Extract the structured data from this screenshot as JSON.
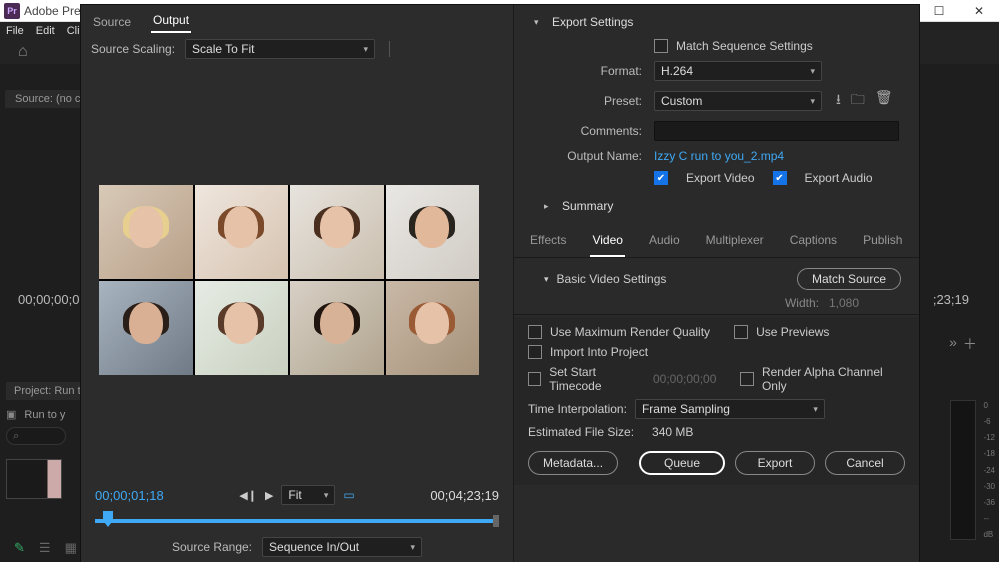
{
  "app": {
    "title": "Adobe Prem",
    "icon_text": "Pr"
  },
  "menubar": [
    "File",
    "Edit",
    "Clip"
  ],
  "source_tab_label": "Source: (no cli",
  "bg_timeline": {
    "left_tc": "00;00;00;0",
    "right_tc": ";23;19"
  },
  "project": {
    "tab": "Project: Run to",
    "name": "Run to y",
    "search_glyph": "⌕"
  },
  "audio_scale": [
    "0",
    "-6",
    "-12",
    "-18",
    "-24",
    "-30",
    "-36",
    "--",
    "dB"
  ],
  "export": {
    "tabs": {
      "source": "Source",
      "output": "Output"
    },
    "source_scaling_label": "Source Scaling:",
    "source_scaling_value": "Scale To Fit",
    "tc_current": "00;00;01;18",
    "tc_duration": "00;04;23;19",
    "fit_label": "Fit",
    "source_range_label": "Source Range:",
    "source_range_value": "Sequence In/Out",
    "settings_title": "Export Settings",
    "match_seq": "Match Sequence Settings",
    "format_label": "Format:",
    "format_value": "H.264",
    "preset_label": "Preset:",
    "preset_value": "Custom",
    "comments_label": "Comments:",
    "output_name_label": "Output Name:",
    "output_name_value": "Izzy C run to you_2.mp4",
    "export_video": "Export Video",
    "export_audio": "Export Audio",
    "summary": "Summary",
    "subtabs": {
      "effects": "Effects",
      "video": "Video",
      "audio": "Audio",
      "multiplexer": "Multiplexer",
      "captions": "Captions",
      "publish": "Publish"
    },
    "basic_title": "Basic Video Settings",
    "match_source_btn": "Match Source",
    "width_label": "Width:",
    "width_value": "1,080",
    "max_quality": "Use Maximum Render Quality",
    "use_previews": "Use Previews",
    "import_project": "Import Into Project",
    "set_start_tc": "Set Start Timecode",
    "start_tc_value": "00;00;00;00",
    "render_alpha": "Render Alpha Channel Only",
    "time_interp_label": "Time Interpolation:",
    "time_interp_value": "Frame Sampling",
    "est_label": "Estimated File Size:",
    "est_value": "340 MB",
    "buttons": {
      "metadata": "Metadata...",
      "queue": "Queue",
      "export": "Export",
      "cancel": "Cancel"
    }
  }
}
